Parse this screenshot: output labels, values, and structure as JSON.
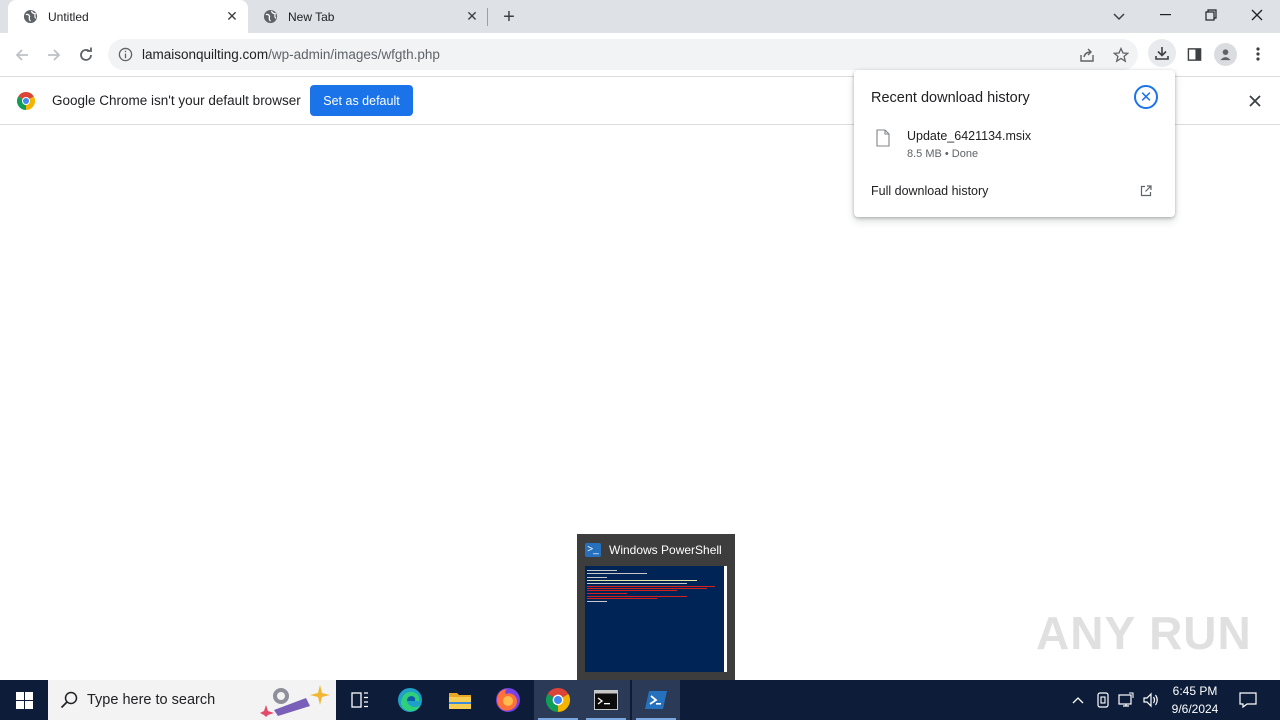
{
  "tabs": [
    {
      "title": "Untitled",
      "active": true
    },
    {
      "title": "New Tab",
      "active": false
    }
  ],
  "address": {
    "host": "lamaisonquilting.com",
    "path": "/wp-admin/images/wfgth.php"
  },
  "infobar": {
    "message": "Google Chrome isn't your default browser",
    "button": "Set as default"
  },
  "downloads": {
    "title": "Recent download history",
    "items": [
      {
        "filename": "Update_6421134.msix",
        "status": "8.5 MB • Done"
      }
    ],
    "full_history": "Full download history"
  },
  "powershell_preview": {
    "title": "Windows PowerShell"
  },
  "watermark": "ANY RUN",
  "taskbar": {
    "search_placeholder": "Type here to search",
    "apps": [
      "task-view",
      "edge",
      "file-explorer",
      "firefox",
      "chrome",
      "cmd",
      "powershell"
    ],
    "active_apps": [
      "chrome",
      "cmd",
      "powershell"
    ],
    "time": "6:45 PM",
    "date": "9/6/2024"
  },
  "colors": {
    "accent": "#1a73e8",
    "taskbar": "#0d1d39",
    "powershell_bg": "#012456"
  }
}
